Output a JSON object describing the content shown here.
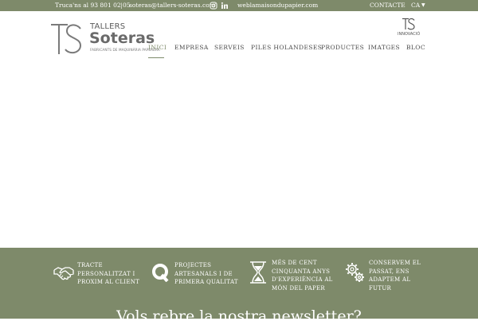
{
  "topbar": {
    "call_text": "Truca'ns al 93 801 02 05",
    "separator": "|",
    "email": "soteras@tallers-soteras.com",
    "website": "weblamaisondupapier.com",
    "contact": "CONTACTE",
    "language": "CA",
    "icons": [
      "instagram-icon",
      "linkedin-icon",
      "caret-down-icon"
    ]
  },
  "logo": {
    "mark": "TS",
    "tallers": "TALLERS",
    "name": "Soteras",
    "tagline": "FABRICANTS DE MAQUINÀRIA PAPERERA"
  },
  "innovacio": {
    "mark": "TS",
    "label": "INNOVACIÓ"
  },
  "nav": {
    "items": [
      "INICI",
      "EMPRESA",
      "SERVEIS",
      "PILES HOLANDESES",
      "PRODUCTES",
      "IMATGES",
      "BLOC"
    ],
    "active_index": 0
  },
  "features": [
    {
      "icon": "handshake-icon",
      "lines": [
        "TRACTE",
        "PERSONALITZAT I",
        "PROXIM AL CLIENT"
      ]
    },
    {
      "icon": "q-icon",
      "lines": [
        "PROJECTES",
        "ARTESANALS I DE",
        "PRIMERA QUALITAT"
      ]
    },
    {
      "icon": "hourglass-icon",
      "lines": [
        "MÉS DE CENT",
        "CINQUANTA ANYS",
        "D'EXPERIÈNCIA AL",
        "MÓN DEL PAPER"
      ]
    },
    {
      "icon": "gears-icon",
      "lines": [
        "CONSERVEM EL",
        "PASSAT, ENS",
        "ADAPTEM AL",
        "FUTUR"
      ]
    }
  ],
  "newsletter": {
    "title": "Vols rebre la nostra newsletter?"
  },
  "colors": {
    "brand_green": "#7e8a6a",
    "text_dark": "#4a4a4a",
    "white": "#ffffff"
  }
}
